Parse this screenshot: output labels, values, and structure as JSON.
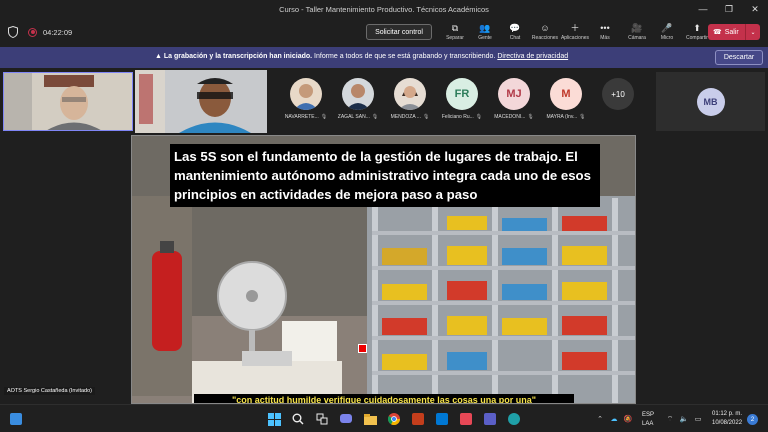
{
  "window": {
    "title": "Curso - Taller Mantenimiento Productivo. Técnicos Académicos",
    "controls": {
      "minimize": "—",
      "restore": "❐",
      "close": "✕"
    }
  },
  "toolbar": {
    "timer": "04:22:09",
    "request_control": "Solicitar control",
    "items": [
      {
        "label": "Separar",
        "icon": "⧉"
      },
      {
        "label": "Gente",
        "icon": "👥"
      },
      {
        "label": "Chat",
        "icon": "💬"
      },
      {
        "label": "Reacciones",
        "icon": "☺"
      },
      {
        "label": "Aplicaciones",
        "icon": "＋"
      },
      {
        "label": "Más",
        "icon": "•••"
      }
    ],
    "right_items": [
      {
        "label": "Cámara",
        "icon": "🎥"
      },
      {
        "label": "Micro",
        "icon": "🎤"
      },
      {
        "label": "Compartir",
        "icon": "⬆"
      }
    ],
    "leave": "Salir"
  },
  "banner": {
    "bold": "La grabación y la transcripción han iniciado.",
    "text": "Informe a todos de que se está grabando y transcribiendo.",
    "link": "Directiva de privacidad",
    "discard": "Descartar"
  },
  "participants": [
    {
      "name": "NAVARRETE...",
      "initials": "",
      "bg": "#e8d9c8"
    },
    {
      "name": "ZAGAL SAN...",
      "initials": "",
      "bg": "#d4d8dc"
    },
    {
      "name": "MENDOZA ...",
      "initials": "",
      "bg": "#e6ddd3"
    },
    {
      "name": "Feliciano Ru...",
      "initials": "FR",
      "bg": "#d9eee3",
      "fg": "#2e7d5b"
    },
    {
      "name": "MACEDONI...",
      "initials": "MJ",
      "bg": "#f3d7d9",
      "fg": "#b23a48"
    },
    {
      "name": "MAYRA (Inv...",
      "initials": "M",
      "bg": "#fbdcd6",
      "fg": "#c0392b"
    }
  ],
  "more_count": "+10",
  "tile_mb": "MB",
  "slide": {
    "caption": "Las 5S son el fundamento de la gestión de lugares de trabajo. El mantenimiento autónomo administrativo integra cada uno de esos principios en actividades de mejora paso a paso",
    "bottom_caption": "\"con actitud humilde verifique cuidadosamente las cosas una por una\""
  },
  "presenter_label": "AOTS Sergio Castañeda (Invitado)",
  "taskbar": {
    "lang1": "ESP",
    "lang2": "LAA",
    "time": "01:12 p. m.",
    "date": "10/08/2022",
    "notif": "2"
  }
}
